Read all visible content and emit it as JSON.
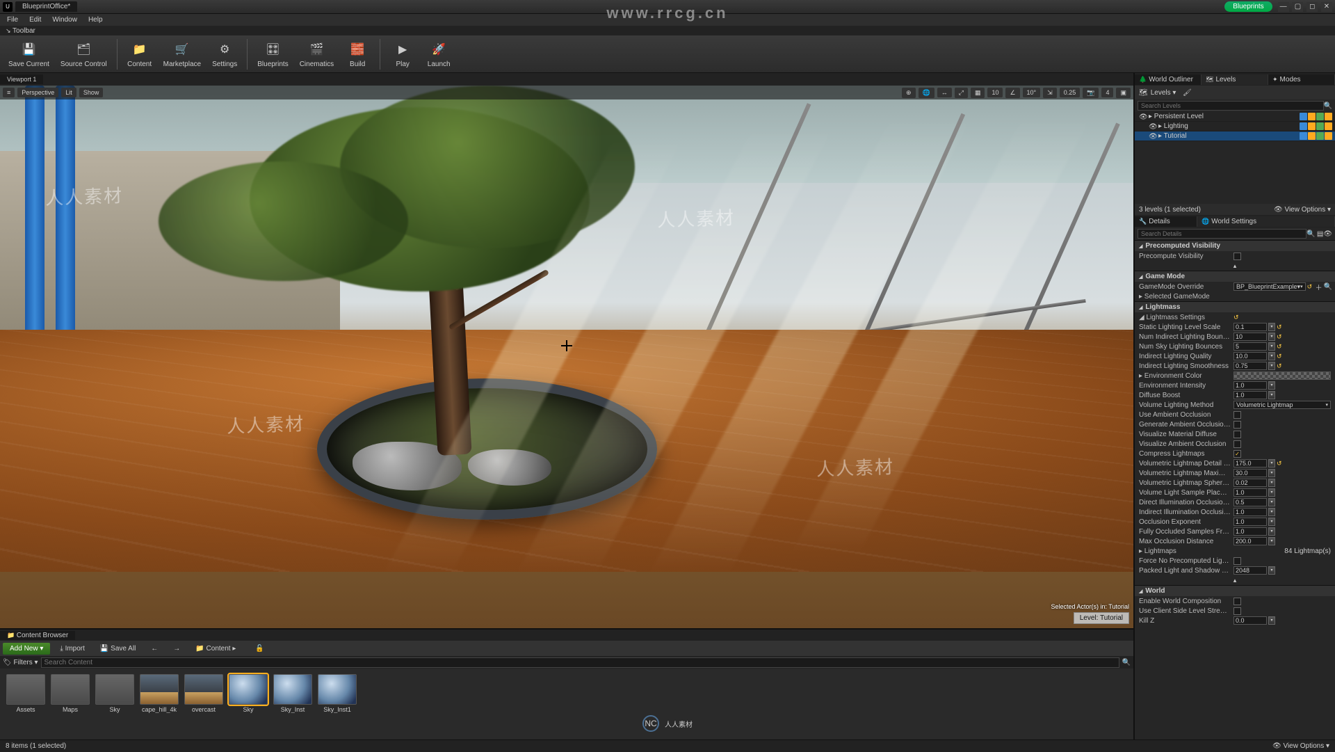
{
  "title_tab": "BlueprintOffice*",
  "bp_pill": "Blueprints",
  "menu": [
    "File",
    "Edit",
    "Window",
    "Help"
  ],
  "toolbar_label": "Toolbar",
  "toolbar": [
    {
      "label": "Save Current",
      "icon": "💾"
    },
    {
      "label": "Source Control",
      "icon": "🗂"
    },
    {
      "label": "Content",
      "icon": "📁"
    },
    {
      "label": "Marketplace",
      "icon": "🛒"
    },
    {
      "label": "Settings",
      "icon": "⚙"
    },
    {
      "label": "Blueprints",
      "icon": "🎛"
    },
    {
      "label": "Cinematics",
      "icon": "🎬"
    },
    {
      "label": "Build",
      "icon": "🧱"
    },
    {
      "label": "Play",
      "icon": "▶"
    },
    {
      "label": "Launch",
      "icon": "🚀"
    }
  ],
  "viewport_tab": "Viewport 1",
  "viewport_left": [
    "≡",
    "Perspective",
    "Lit",
    "Show"
  ],
  "viewport_right_vals": {
    "a": "10",
    "b": "10°",
    "c": "0.25",
    "d": "4"
  },
  "selected_overlay": "Selected Actor(s) in:\nTutorial",
  "level_badge": "Level: Tutorial",
  "content_browser": {
    "tab": "Content Browser",
    "add": "Add New ▾",
    "import": "Import",
    "saveall": "Save All",
    "path_label": "Content",
    "filters": "Filters ▾",
    "search_ph": "Search Content",
    "assets": [
      {
        "label": "Assets",
        "cls": "folder"
      },
      {
        "label": "Maps",
        "cls": "folder"
      },
      {
        "label": "Sky",
        "cls": "folder"
      },
      {
        "label": "cape_hill_4k",
        "cls": "sky"
      },
      {
        "label": "overcast",
        "cls": "sky"
      },
      {
        "label": "Sky",
        "cls": "sphere sel"
      },
      {
        "label": "Sky_Inst",
        "cls": "sphere"
      },
      {
        "label": "Sky_Inst1",
        "cls": "sphere"
      }
    ],
    "status": "8 items (1 selected)",
    "viewopts": "View Options ▾"
  },
  "right": {
    "tabs_top": [
      "World Outliner",
      "Levels",
      "Modes"
    ],
    "levels_label": "Levels ▾",
    "search_levels_ph": "Search Levels",
    "tree": [
      {
        "label": "Persistent Level",
        "indent": 0,
        "sel": false
      },
      {
        "label": "Lighting",
        "indent": 1,
        "sel": false
      },
      {
        "label": "Tutorial",
        "indent": 1,
        "sel": true
      }
    ],
    "levels_foot_left": "3 levels (1 selected)",
    "levels_foot_right": "View Options ▾",
    "tabs_mid": [
      "Details",
      "World Settings"
    ],
    "search_details_ph": "Search Details",
    "precomp": {
      "header": "Precomputed Visibility",
      "row": "Precompute Visibility"
    },
    "gamemode": {
      "header": "Game Mode",
      "override": "GameMode Override",
      "override_val": "BP_BlueprintExample▾",
      "selected": "Selected GameMode"
    },
    "lightmass": {
      "header": "Lightmass",
      "settings": "Lightmass Settings",
      "rows": [
        {
          "k": "Static Lighting Level Scale",
          "v": "0.1",
          "reset": true
        },
        {
          "k": "Num Indirect Lighting Bounces",
          "v": "10",
          "reset": true
        },
        {
          "k": "Num Sky Lighting Bounces",
          "v": "5",
          "reset": true
        },
        {
          "k": "Indirect Lighting Quality",
          "v": "10.0",
          "reset": true
        },
        {
          "k": "Indirect Lighting Smoothness",
          "v": "0.75",
          "reset": true
        }
      ],
      "env_color": "Environment Color",
      "rows2": [
        {
          "k": "Environment Intensity",
          "v": "1.0"
        },
        {
          "k": "Diffuse Boost",
          "v": "1.0"
        }
      ],
      "vlm": {
        "k": "Volume Lighting Method",
        "v": "Volumetric Lightmap"
      },
      "checks": [
        {
          "k": "Use Ambient Occlusion",
          "c": false
        },
        {
          "k": "Generate Ambient Occlusion Material M",
          "c": false
        },
        {
          "k": "Visualize Material Diffuse",
          "c": false
        },
        {
          "k": "Visualize Ambient Occlusion",
          "c": false
        },
        {
          "k": "Compress Lightmaps",
          "c": true
        }
      ],
      "rows3": [
        {
          "k": "Volumetric Lightmap Detail Cell Size",
          "v": "175.0",
          "reset": true
        },
        {
          "k": "Volumetric Lightmap Maximum Brick M",
          "v": "30.0"
        },
        {
          "k": "Volumetric Lightmap Spherical Harmon",
          "v": "0.02"
        },
        {
          "k": "Volume Light Sample Placement Scale",
          "v": "1.0"
        },
        {
          "k": "Direct Illumination Occlusion Fraction",
          "v": "0.5"
        },
        {
          "k": "Indirect Illumination Occlusion Fraction",
          "v": "1.0"
        },
        {
          "k": "Occlusion Exponent",
          "v": "1.0"
        },
        {
          "k": "Fully Occluded Samples Fraction",
          "v": "1.0"
        },
        {
          "k": "Max Occlusion Distance",
          "v": "200.0"
        }
      ],
      "lm_row": {
        "k": "Lightmaps",
        "v": "84 Lightmap(s)"
      },
      "force": {
        "k": "Force No Precomputed Lighting"
      },
      "packed": {
        "k": "Packed Light and Shadow Map Texture Siz",
        "v": "2048"
      }
    },
    "world": {
      "header": "World",
      "checks": [
        {
          "k": "Enable World Composition"
        },
        {
          "k": "Use Client Side Level Streaming Volumes"
        }
      ],
      "killz": {
        "k": "Kill Z",
        "v": "0.0"
      }
    }
  },
  "watermarks": {
    "url": "www.rrcg.cn",
    "stamp": "人人素材"
  }
}
